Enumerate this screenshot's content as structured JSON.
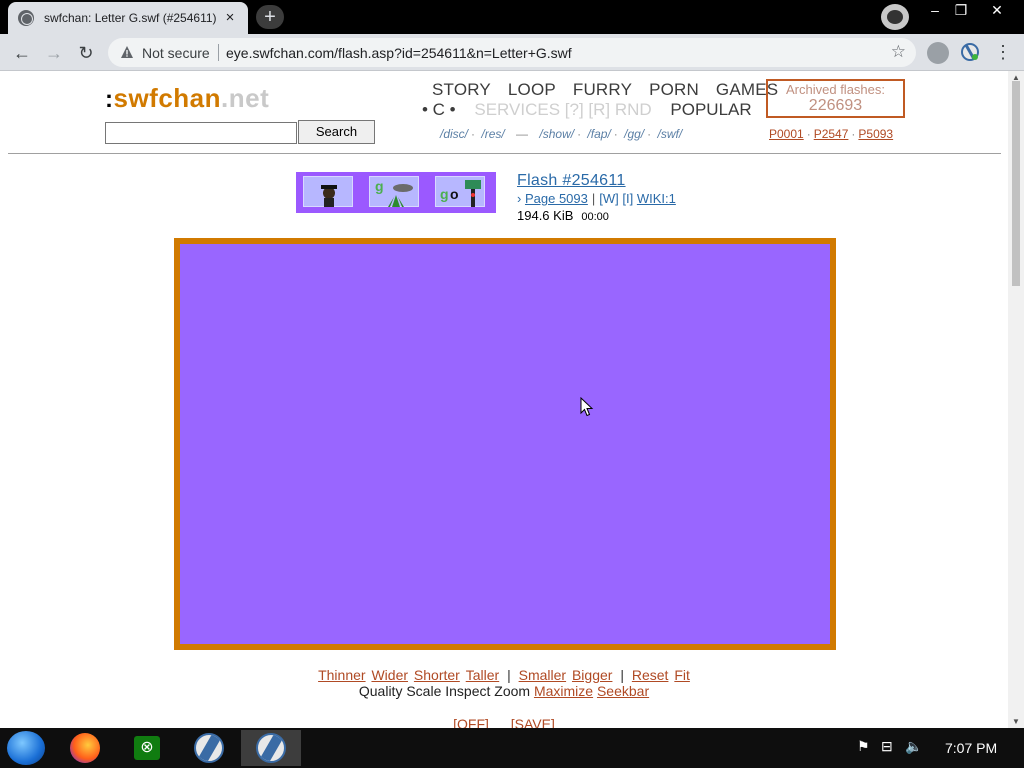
{
  "browser": {
    "tab_title": "swfchan: Letter G.swf (#254611)",
    "tab_close": "×",
    "new_tab": "+",
    "not_secure": "Not secure",
    "url": "eye.swfchan.com/flash.asp?id=254611&n=Letter+G.swf",
    "window_controls": [
      "–",
      "❐",
      "✕"
    ]
  },
  "site": {
    "logo_dots": ":",
    "logo_part1": "swfchan",
    "logo_part2": ".net",
    "search_placeholder": "",
    "search_button": "Search",
    "nav_row1": [
      "STORY",
      "LOOP",
      "FURRY",
      "PORN",
      "GAMES"
    ],
    "nav_row2_c": "• C •",
    "nav_row2_dim": "SERVICES [?] [R] RND",
    "nav_row2_popular": "POPULAR",
    "boards": [
      "/disc/",
      "/res/",
      "—",
      "/show/",
      "/fap/",
      "/gg/",
      "/swf/"
    ],
    "archived_label": "Archived flashes:",
    "archived_count": "226693",
    "page_links": [
      "P0001",
      "P2547",
      "P5093"
    ]
  },
  "flash": {
    "title": "Flash #254611",
    "page_prefix": "›",
    "page_link": "Page 5093",
    "w_link": "[W]",
    "i_link": "[I]",
    "wiki_link": "WIKI:1",
    "size": "194.6 KiB",
    "duration": "00:00",
    "player_color": "#9966ff",
    "frame_color": "#d17a00"
  },
  "controls": {
    "size_links": [
      "Thinner",
      "Wider",
      "Shorter",
      "Taller"
    ],
    "zoom_links": [
      "Smaller",
      "Bigger"
    ],
    "reset_links": [
      "Reset",
      "Fit"
    ],
    "plain_text": "Quality Scale Inspect Zoom",
    "maximize": "Maximize",
    "seekbar": "Seekbar",
    "off": "[OFF]",
    "save": "[SAVE]"
  },
  "taskbar": {
    "clock": "7:07 PM"
  }
}
